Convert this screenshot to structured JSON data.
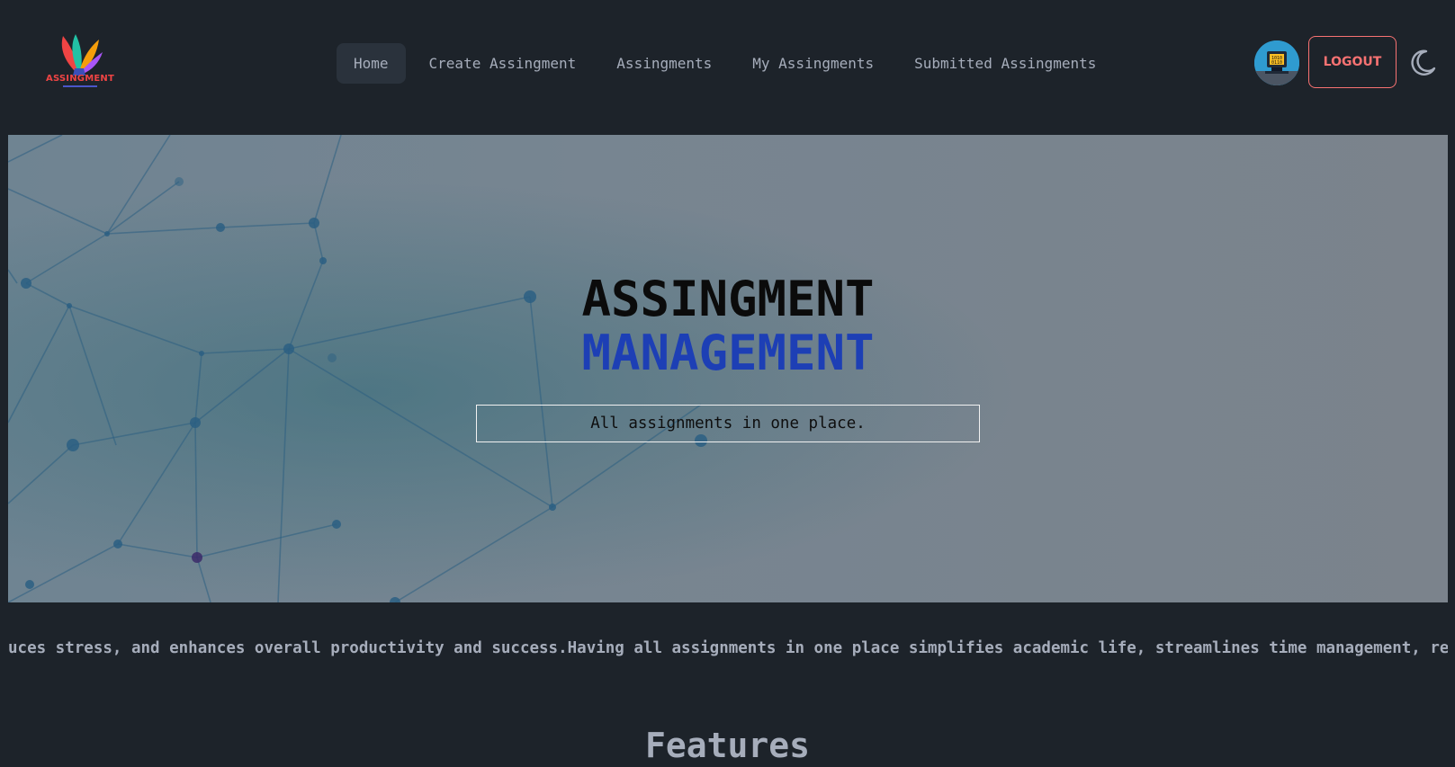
{
  "navbar": {
    "logo_text": "ASSINGMENT",
    "menu": [
      {
        "label": "Home",
        "active": true
      },
      {
        "label": "Create Assingment",
        "active": false
      },
      {
        "label": "Assingments",
        "active": false
      },
      {
        "label": "My Assingments",
        "active": false
      },
      {
        "label": "Submitted Assingments",
        "active": false
      }
    ],
    "logout_label": "LOGOUT",
    "theme_icon": "moon-icon",
    "avatar_icon": "computer-avatar"
  },
  "hero": {
    "title_line1": "ASSINGMENT",
    "title_line2": "MANAGEMENT",
    "tagline": "All assignments in one place."
  },
  "marquee": {
    "text": "uces stress, and enhances overall productivity and success.Having all assignments in one place simplifies academic life, streamlines time management, red"
  },
  "features": {
    "title": "Features"
  },
  "colors": {
    "background": "#1d232a",
    "accent_blue": "#1d3fb5",
    "logout_red": "#f87272",
    "active_tab_bg": "#2a323c"
  }
}
